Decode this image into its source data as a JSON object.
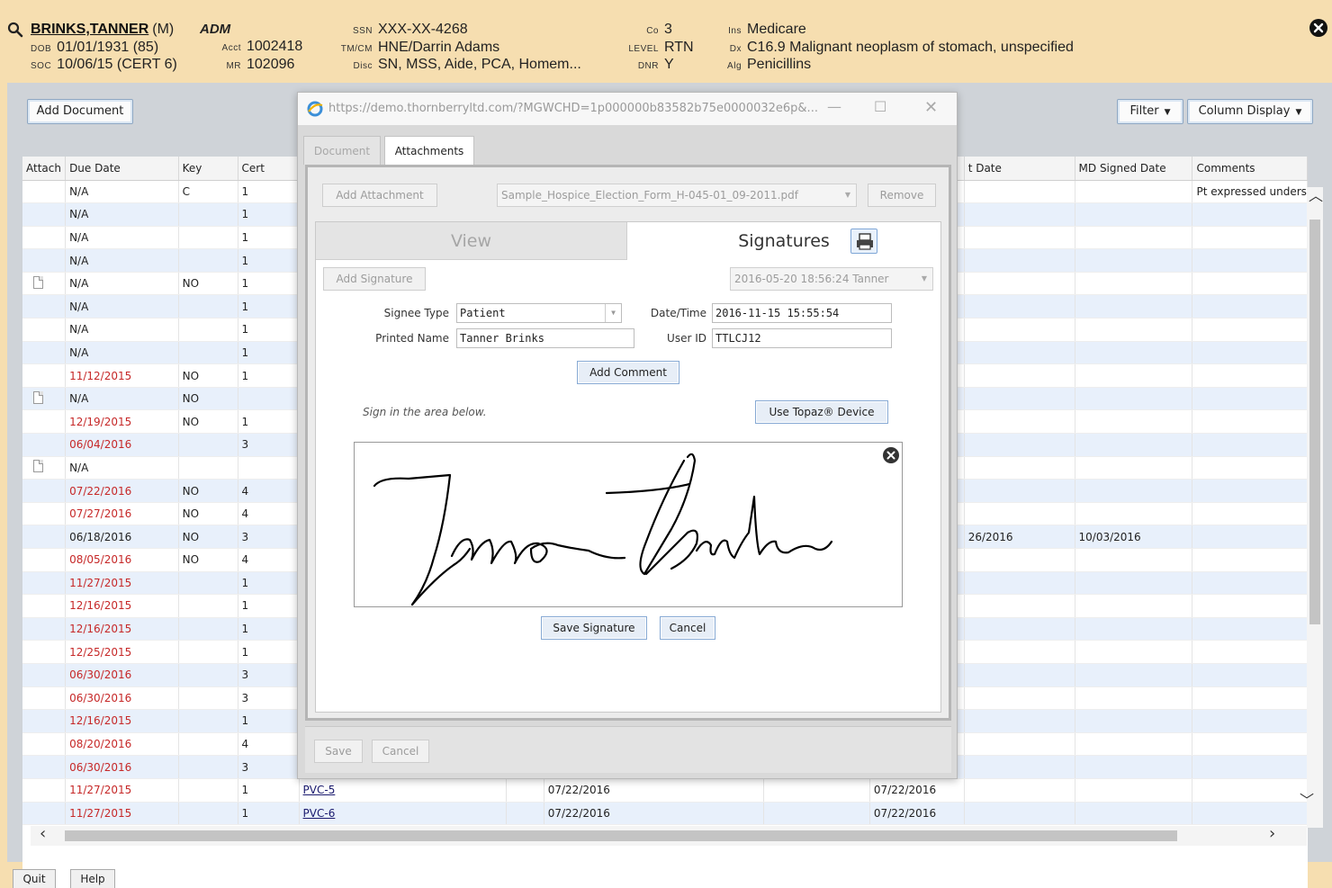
{
  "patient": {
    "name": "BRINKS,TANNER",
    "sex": "(M)",
    "status": "ADM",
    "dob_label": "DOB",
    "dob": "01/01/1931 (85)",
    "soc_label": "SOC",
    "soc": "10/06/15 (CERT 6)",
    "acct_label": "Acct",
    "acct": "1002418",
    "mr_label": "MR",
    "mr": "102096",
    "ssn_label": "SSN",
    "ssn": "XXX-XX-4268",
    "tmcm_label": "TM/CM",
    "tmcm": "HNE/Darrin Adams",
    "disc_label": "Disc",
    "disc": "SN, MSS, Aide, PCA, Homem...",
    "co_label": "Co",
    "co": "3",
    "level_label": "LEVEL",
    "level": "RTN",
    "dnr_label": "DNR",
    "dnr": "Y",
    "ins_label": "Ins",
    "ins": "Medicare",
    "dx_label": "Dx",
    "dx": "C16.9 Malignant neoplasm of stomach, unspecified",
    "alg_label": "Alg",
    "alg": "Penicillins"
  },
  "toolbar": {
    "add_document": "Add Document",
    "filter": "Filter",
    "column_display": "Column Display"
  },
  "grid": {
    "columns": {
      "attach": "Attach",
      "due_date": "Due Date",
      "key": "Key",
      "cert": "Cert",
      "doc": "",
      "col6": "",
      "col7": "",
      "col8": "",
      "col9": "",
      "sent_date": "t Date",
      "md_signed_date": "MD Signed Date",
      "comments": "Comments"
    },
    "rows": [
      {
        "due": "N/A",
        "key": "C",
        "cert": "1",
        "comments": "Pt expressed unders"
      },
      {
        "due": "N/A",
        "key": "",
        "cert": "1"
      },
      {
        "due": "N/A",
        "key": "",
        "cert": "1"
      },
      {
        "due": "N/A",
        "key": "",
        "cert": "1"
      },
      {
        "due": "N/A",
        "key": "NO",
        "cert": "1",
        "attach": true
      },
      {
        "due": "N/A",
        "key": "",
        "cert": "1"
      },
      {
        "due": "N/A",
        "key": "",
        "cert": "1"
      },
      {
        "due": "N/A",
        "key": "",
        "cert": "1"
      },
      {
        "due": "11/12/2015",
        "key": "NO",
        "cert": "1",
        "late": true
      },
      {
        "due": "N/A",
        "key": "NO",
        "cert": "",
        "attach": true
      },
      {
        "due": "12/19/2015",
        "key": "NO",
        "cert": "1",
        "late": true
      },
      {
        "due": "06/04/2016",
        "key": "",
        "cert": "3",
        "late": true
      },
      {
        "due": "N/A",
        "key": "",
        "cert": "",
        "attach": true
      },
      {
        "due": "07/22/2016",
        "key": "NO",
        "cert": "4",
        "late": true
      },
      {
        "due": "07/27/2016",
        "key": "NO",
        "cert": "4",
        "late": true
      },
      {
        "due": "06/18/2016",
        "key": "NO",
        "cert": "3",
        "sent": "26/2016",
        "md": "10/03/2016"
      },
      {
        "due": "08/05/2016",
        "key": "NO",
        "cert": "4",
        "late": true
      },
      {
        "due": "11/27/2015",
        "key": "",
        "cert": "1",
        "late": true
      },
      {
        "due": "12/16/2015",
        "key": "",
        "cert": "1",
        "late": true
      },
      {
        "due": "12/16/2015",
        "key": "",
        "cert": "1",
        "late": true
      },
      {
        "due": "12/25/2015",
        "key": "",
        "cert": "1",
        "late": true
      },
      {
        "due": "06/30/2016",
        "key": "",
        "cert": "3",
        "late": true
      },
      {
        "due": "06/30/2016",
        "key": "",
        "cert": "3",
        "late": true
      },
      {
        "due": "12/16/2015",
        "key": "",
        "cert": "1",
        "late": true
      },
      {
        "due": "08/20/2016",
        "key": "",
        "cert": "4",
        "late": true
      },
      {
        "due": "06/30/2016",
        "key": "",
        "cert": "3",
        "late": true
      },
      {
        "due": "11/27/2015",
        "key": "",
        "cert": "1",
        "late": true,
        "doc": "PVC-5",
        "d1": "07/22/2016",
        "d2": "07/22/2016"
      },
      {
        "due": "11/27/2015",
        "key": "",
        "cert": "1",
        "late": true,
        "doc": "PVC-6",
        "d1": "07/22/2016",
        "d2": "07/22/2016"
      }
    ]
  },
  "footer": {
    "quit": "Quit",
    "help": "Help"
  },
  "dialog": {
    "url": "https://demo.thornberryltd.com/?MGWCHD=1p000000b83582b75e0000032e6p&...",
    "tabs": {
      "document": "Document",
      "attachments": "Attachments"
    },
    "add_attachment": "Add Attachment",
    "attachment_file": "Sample_Hospice_Election_Form_H-045-01_09-2011.pdf",
    "remove": "Remove",
    "view_tab": "View",
    "signatures_tab": "Signatures",
    "add_signature": "Add Signature",
    "signature_select": "2016-05-20 18:56:24 Tanner",
    "signee_type_label": "Signee Type",
    "signee_type": "Patient",
    "printed_name_label": "Printed Name",
    "printed_name": "Tanner Brinks",
    "datetime_label": "Date/Time",
    "datetime": "2016-11-15 15:55:54",
    "user_id_label": "User ID",
    "user_id": "TTLCJ12",
    "add_comment": "Add Comment",
    "sign_hint": "Sign in the area below.",
    "use_topaz": "Use Topaz® Device",
    "save_signature": "Save Signature",
    "cancel": "Cancel",
    "save": "Save",
    "footer_cancel": "Cancel"
  },
  "colors": {
    "header_bg": "#f6deb0",
    "panel_bg": "#cfd3d8",
    "late_text": "#c62828",
    "row_alt": "#e8f0fb",
    "button_border": "#86a9d4"
  }
}
